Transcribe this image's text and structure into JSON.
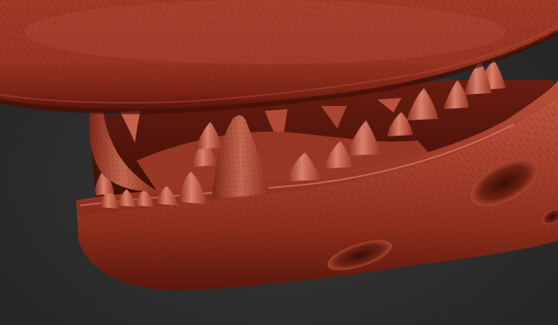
{
  "scene": {
    "subject": "sculpted-creature-jaw",
    "colors": {
      "background": "#2c2c2c",
      "clay_base": "#8a2a1a",
      "clay_light": "#c4604a",
      "clay_highlight": "#e08a72",
      "clay_shadow": "#4a120a",
      "wire": "#6e2416"
    }
  }
}
